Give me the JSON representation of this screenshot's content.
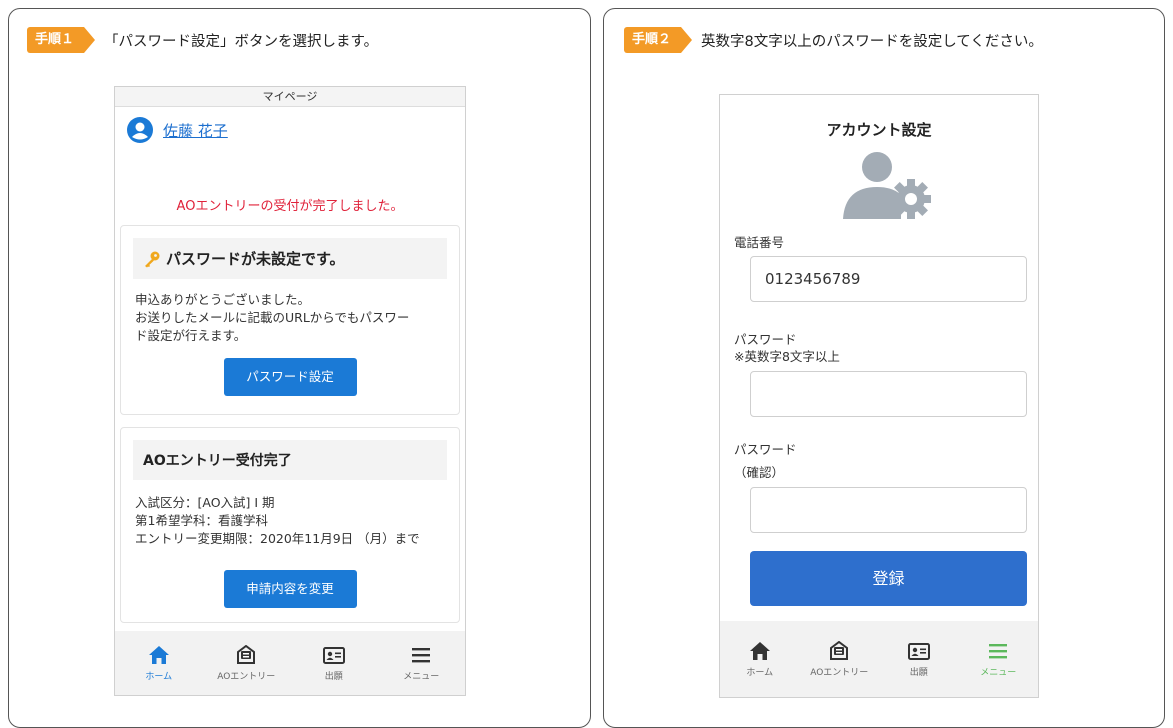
{
  "step1": {
    "badge": "手順１",
    "text": "「パスワード設定」ボタンを選択します。",
    "phone": {
      "title": "マイページ",
      "user_name": "佐藤 花子",
      "notice": "AOエントリーの受付が完了しました。",
      "password_card": {
        "heading": "パスワードが未設定です。",
        "body_line1": "申込ありがとうございました。",
        "body_line2": "お送りしたメールに記載のURLからでもパスワー",
        "body_line3": "ド設定が行えます。",
        "button": "パスワード設定"
      },
      "entry_card": {
        "heading": "AOエントリー受付完了",
        "line1": "入試区分：[AO入試] I 期",
        "line2": "第1希望学科：看護学科",
        "line3": "エントリー変更期限：2020年11月9日 （月）まで",
        "button": "申請内容を変更"
      },
      "nav": [
        "ホーム",
        "AOエントリー",
        "出願",
        "メニュー"
      ]
    }
  },
  "step2": {
    "badge": "手順２",
    "text": "英数字8文字以上のパスワードを設定してください。",
    "phone": {
      "title": "アカウント設定",
      "phone_label": "電話番号",
      "phone_value": "0123456789",
      "password_label": "パスワード",
      "password_hint": "※英数字8文字以上",
      "password_value": "",
      "confirm_label": "パスワード",
      "confirm_hint": "（確認）",
      "confirm_value": "",
      "register_button": "登録",
      "nav": [
        "ホーム",
        "AOエントリー",
        "出願",
        "メニュー"
      ]
    }
  },
  "colors": {
    "badge": "#f39a26",
    "primary_blue": "#1b7ad6",
    "register_blue": "#2e6fcd",
    "notice_red": "#e0223a",
    "menu_green": "#5cb85c"
  },
  "icons": [
    "user-avatar-icon",
    "key-icon",
    "home-icon",
    "envelope-icon",
    "id-card-icon",
    "menu-icon",
    "user-gear-icon"
  ]
}
